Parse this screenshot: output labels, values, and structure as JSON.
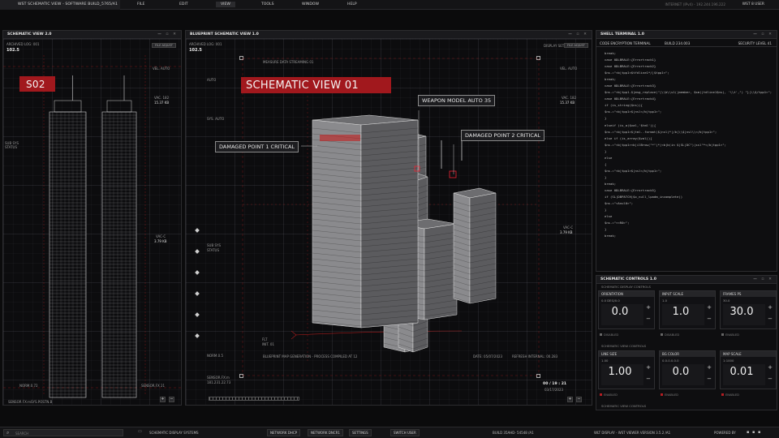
{
  "topbar": {
    "app_title": "WST SCHEMATIC VIEW - SOFTWARE BUILD_5765/A1",
    "menus": [
      "FILE",
      "EDIT",
      "VIEW",
      "TOOLS",
      "WINDOW",
      "HELP"
    ],
    "active_menu": "VIEW",
    "status": "INTERNET (IPv4) - 192.244.196.222",
    "user": "WST 8 USER"
  },
  "left_panel": {
    "title": "SCHEMATIC VIEW 2.0",
    "archived_label": "ARCHIVED LOG: 001",
    "archived_value": "102.5",
    "chip": "FILE ADJUST",
    "red_label": "S02",
    "labels": [
      "VEL. AUTO",
      "VAC. 182",
      "15.37 KB",
      "VAC-C",
      "3.79 KB",
      "SUB SYS",
      "STATUS",
      "SENSOR.FX 21",
      "NORM.0.72"
    ],
    "footer_left": "SENSOR FX:m",
    "footer_right": "SYS.POSTN.B"
  },
  "center_panel": {
    "title": "BLUEPRINT SCHEMATIC VIEW 1.0",
    "archived_label": "ARCHIVED LOG: 001",
    "archived_value": "102.5",
    "display_label": "DISPLAY SET",
    "chip": "FILE ADJUST",
    "red_title": "SCHEMATIC VIEW 01",
    "measure_label": "MEASURE DATA STREAMING 01",
    "callouts": {
      "damaged_1": "DAMAGED POINT 1 CRITICAL",
      "weapon": "WEAPON MODEL AUTO 35",
      "damaged_2": "DAMAGED POINT 2 CRITICAL"
    },
    "side_labels": [
      "AUTO",
      "SYS. AUTO",
      "NORM.0.5",
      "SUB SYS",
      "STATUS",
      "SENSOR.FX:m",
      "181.231.22.73",
      "VEL. AUTO",
      "VAC. 182",
      "15.37 KB",
      "VAC-C",
      "3.79 KB"
    ],
    "bottom_labels": {
      "blueprint": "BLUEPRINT MAP GENERATION - PROCESS COMPILED AT 12",
      "date": "DATE: 05/07/2023",
      "refresh": "REFRESH INTERNAL: 00.283",
      "flt": "FLT",
      "flt2": "INIT. 01"
    },
    "time": "00 / 19 : 21",
    "date2": "03/17/2023"
  },
  "terminal": {
    "title": "SHELL TERMINAL 1.0",
    "sub_left": "CODE ENCRYPTION TERMINAL",
    "sub_mid": "BUILD 234.003",
    "sub_right": "SECURITY LEVEL 41",
    "lines": [
      "break;",
      "case 0DLBRALE:{Errortrack1}",
      "case 0DLBRALE:{Errortrack2}",
      "$ns.=\"<b|tpp1<$tfdline1*/|$tpp1<\";",
      "break;",
      "case 0DLBRALE:{Errortrack3}",
      "$ns.=\"<b|tpp1.$|msg_replace(\"|\\\\b\\\\s1(|member, $sm(|tdline1$ns), '\\\\t',\") \"}|\\\\$/tpp1>\";",
      "case 0DLBRALE:{Errortrack4}",
      "if (is_string($ns)){",
      "$ns.=\"<b|tpp1>$|nsl</b|tpp1>\";",
      "}",
      "elseif (is_a($val,'$tml')){",
      "$ns.=\"<b|tpp1>$|tml..format($|nsl)*|/b|\\\\$|nsl\\\\</b|tpp1>\";",
      "else if (is_array($val)){",
      "$ns.=\"<b|tpp1><b|ilBrow(\"*\"|*|<b|b(in $|SL|DC\")|ssl\"*</b|tpp1>\";",
      "}",
      "else",
      "{",
      "$ns.=\"<b|tpp1>$|nsl</b|tpp1>\";",
      "}",
      "break;",
      "case 0DLBRALE:{Errortrack5}",
      "if (SL|DBPATCH|$x_null_lpadm_incomplete))",
      "$ns.=\"<Anul0>\";",
      "}",
      "else",
      "$ns.=\"<<R0>\";",
      "}",
      "break;"
    ]
  },
  "controls": {
    "title": "SCHEMATIC CONTROLS 1.0",
    "section1_label": "SCHEMATIC DISPLAY CONTROLS",
    "section2_label": "SCHEMATIC VIEW CONTROLS",
    "section3_label": "SCHEMATIC VIEW CONTROLS",
    "boxes_row1": [
      {
        "title": "ORIENTATION",
        "sub": "0.0 DEG/0.0",
        "value": "0.0",
        "foot": "DISABLED"
      },
      {
        "title": "INPUT SCALE",
        "sub": "1.0",
        "value": "1.0",
        "foot": "DISABLED"
      },
      {
        "title": "FRAMES PS",
        "sub": "30.0",
        "value": "30.0",
        "foot": "ENABLED"
      }
    ],
    "boxes_row2": [
      {
        "title": "LINE SIZE",
        "sub": "1.00",
        "value": "1.00",
        "foot": "ENABLED"
      },
      {
        "title": "BG COLOR",
        "sub": "0.0.0.0.0.0",
        "value": "0.0",
        "foot": "ENABLED"
      },
      {
        "title": "MAP SCALE",
        "sub": "1:1000",
        "value": "0.01",
        "foot": "ENABLED"
      }
    ]
  },
  "bottombar": {
    "search_placeholder": "SEARCH",
    "system_label": "SCHEMATIC DISPLAY SYSTEMS",
    "tabs": [
      "NETWORK DHCP",
      "NETWORK DNCR1",
      "SETTINGS",
      "SWITCH USER"
    ],
    "build": "BUILD 35AHD- 54548 /A1",
    "display": "WLT DISPLAY - WST VIEWER VERSION 3.5.2 /A1",
    "powered": "POWERED BY"
  }
}
